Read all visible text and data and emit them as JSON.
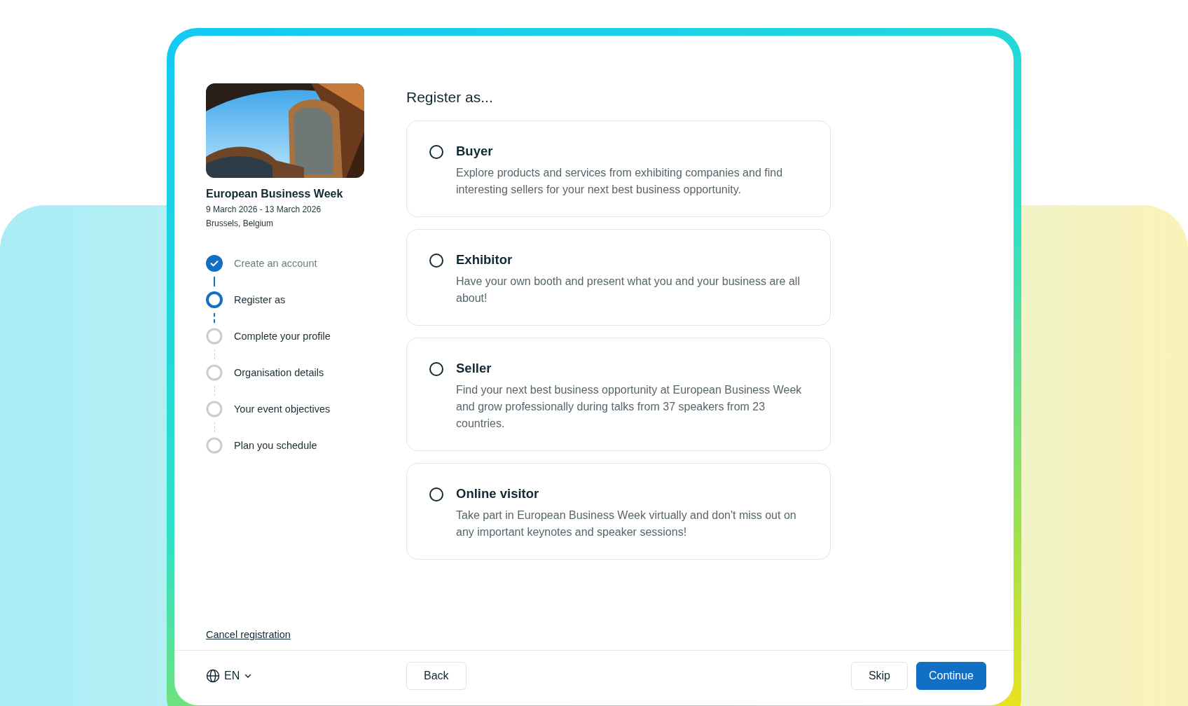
{
  "event": {
    "kind": "picture",
    "name": "European Business Week",
    "dates": "9 March 2026 - 13 March 2026",
    "location": "Brussels, Belgium"
  },
  "steps": [
    {
      "label": "Create an account",
      "completed": true,
      "selected": false
    },
    {
      "label": "Register as",
      "completed": false,
      "selected": true
    },
    {
      "label": "Complete your profile",
      "completed": false,
      "selected": false
    },
    {
      "label": "Organisation details",
      "completed": false,
      "selected": false
    },
    {
      "label": "Your event objectives",
      "completed": false,
      "selected": false
    },
    {
      "label": "Plan you schedule",
      "completed": false,
      "selected": false
    }
  ],
  "heading": "Register as...",
  "options": [
    {
      "title": "Buyer",
      "description": "Explore products and services from exhibiting companies and find interesting sellers for your next best business opportunity.",
      "selected": false
    },
    {
      "title": "Exhibitor",
      "description": "Have your own booth and present what you and your business are all about!",
      "selected": false
    },
    {
      "title": "Seller",
      "description": "Find your next best business opportunity at European Business Week and grow professionally during talks from 37 speakers from 23 countries.",
      "selected": false
    },
    {
      "title": "Online visitor",
      "description": "Take part in European Business Week virtually and don't miss out on any important keynotes and speaker sessions!",
      "selected": false
    }
  ],
  "cancel_link": "Cancel registration",
  "footer": {
    "language": "EN",
    "back": "Back",
    "skip": "Skip",
    "continue": "Continue"
  }
}
